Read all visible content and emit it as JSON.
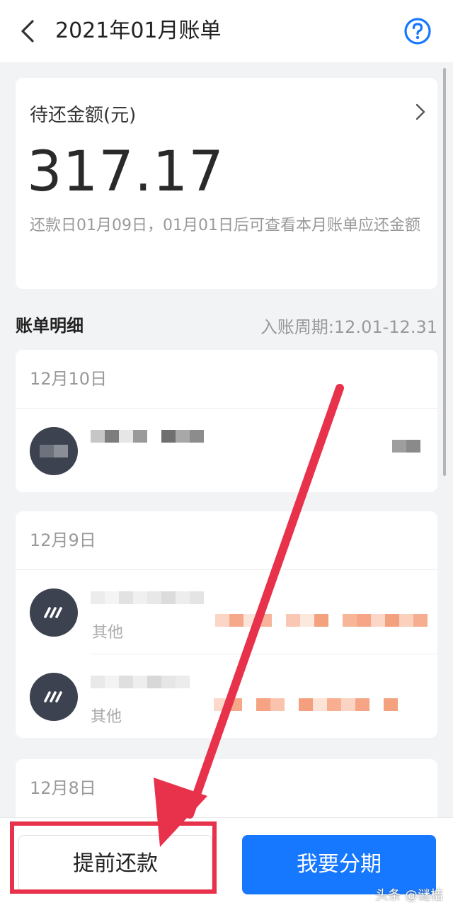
{
  "header": {
    "title": "2021年01月账单",
    "back_icon": "chevron-left-icon",
    "help_icon": "question-circle-icon"
  },
  "summary": {
    "label": "待还金额(元)",
    "amount": "317.17",
    "note": "还款日01月09日，01月01日后可查看本月账单应还金额"
  },
  "details": {
    "title": "账单明细",
    "period": "入账周期:12.01-12.31"
  },
  "groups": [
    {
      "date": "12月10日",
      "rows": [
        {
          "sub": ""
        }
      ]
    },
    {
      "date": "12月9日",
      "rows": [
        {
          "sub": "其他"
        },
        {
          "sub": "其他"
        }
      ]
    },
    {
      "date": "12月8日",
      "rows": []
    }
  ],
  "actions": {
    "prepay_label": "提前还款",
    "installment_label": "我要分期"
  },
  "watermark": "头条 @谜桔",
  "colors": {
    "accent": "#1677ff",
    "annotation": "#e8314a",
    "avatar": "#3d4250"
  }
}
